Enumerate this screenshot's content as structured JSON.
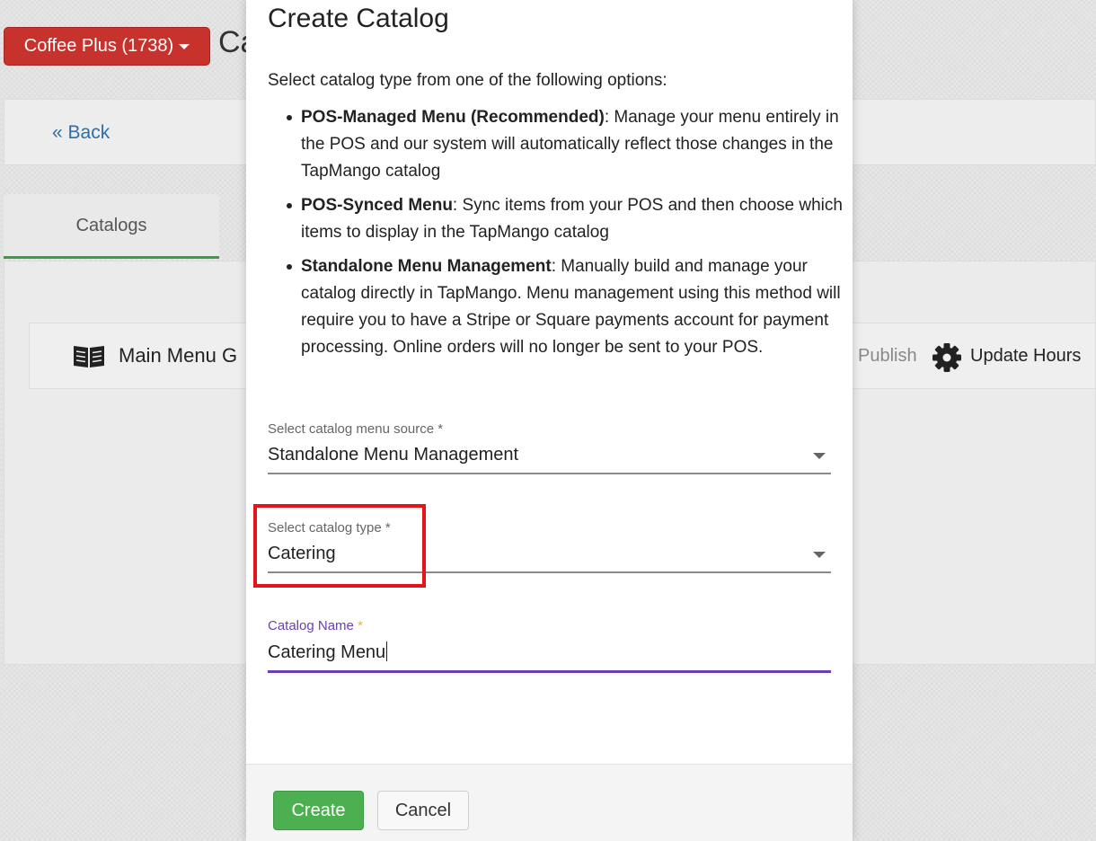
{
  "header": {
    "store_selector": "Coffee Plus (1738)",
    "page_title_partial": "Ca"
  },
  "nav": {
    "back_label": "« Back"
  },
  "tabs": [
    {
      "label": "Catalogs"
    }
  ],
  "catalog_row": {
    "name_partial": "Main Menu G",
    "publish_label": "Publish",
    "update_hours_label": "Update Hours"
  },
  "modal": {
    "title": "Create Catalog",
    "intro": "Select catalog type from one of the following options:",
    "options": [
      {
        "name": "POS-Managed Menu (Recommended)",
        "desc": ": Manage your menu entirely in the POS and our system will automatically reflect those changes in the TapMango catalog"
      },
      {
        "name": "POS-Synced Menu",
        "desc": ": Sync items from your POS and then choose which items to display in the TapMango catalog"
      },
      {
        "name": "Standalone Menu Management",
        "desc": ": Manually build and manage your catalog directly in TapMango. Menu management using this method will require you to have a Stripe or Square payments account for payment processing. Online orders will no longer be sent to your POS."
      }
    ],
    "menu_source": {
      "label": "Select catalog menu source *",
      "value": "Standalone Menu Management"
    },
    "catalog_type": {
      "label": "Select catalog type *",
      "value": "Catering"
    },
    "catalog_name": {
      "label": "Catalog Name",
      "required_mark": "*",
      "value": "Catering Menu"
    },
    "create_label": "Create",
    "cancel_label": "Cancel"
  },
  "colors": {
    "store_button": "#c8322d",
    "link": "#2f6fa8",
    "tab_active_underline": "#3a9d3f",
    "focus_accent": "#6b3fb0",
    "create_button": "#4caf50",
    "highlight_box": "#e5141a"
  },
  "icons": [
    "caret-down-icon",
    "book-open-icon",
    "gear-icon",
    "dropdown-arrow-icon"
  ]
}
